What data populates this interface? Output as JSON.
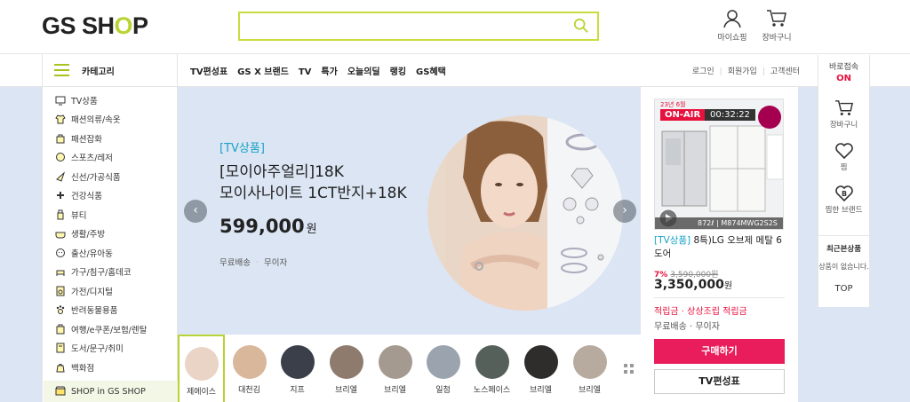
{
  "header": {
    "logo_text_1": "GS SH",
    "logo_text_o": "O",
    "logo_text_2": "P",
    "search_value": "",
    "mypage_label": "마이쇼핑",
    "cart_label": "장바구니"
  },
  "nav": {
    "category_label": "카테고리",
    "menu": [
      "TV편성표",
      "GS X 브랜드",
      "TV",
      "특가",
      "오늘의딜",
      "랭킹",
      "GS혜택"
    ],
    "login": "로그인",
    "join": "회원가입",
    "cs": "고객센터",
    "baro_label": "바로접속",
    "baro_state": "ON"
  },
  "categories": [
    {
      "label": "TV상품",
      "icon": "tv-icon"
    },
    {
      "label": "패션의류/속옷",
      "icon": "shirt-icon"
    },
    {
      "label": "패션잡화",
      "icon": "bag-icon"
    },
    {
      "label": "스포츠/레저",
      "icon": "sports-icon"
    },
    {
      "label": "신선/가공식품",
      "icon": "food-icon"
    },
    {
      "label": "건강식품",
      "icon": "health-icon"
    },
    {
      "label": "뷰티",
      "icon": "beauty-icon"
    },
    {
      "label": "생활/주방",
      "icon": "kitchen-icon"
    },
    {
      "label": "출산/유아동",
      "icon": "baby-icon"
    },
    {
      "label": "가구/침구/홈데코",
      "icon": "furniture-icon"
    },
    {
      "label": "가전/디지털",
      "icon": "appliance-icon"
    },
    {
      "label": "반려동물용품",
      "icon": "pet-icon"
    },
    {
      "label": "여행/e쿠폰/보험/렌탈",
      "icon": "travel-icon"
    },
    {
      "label": "도서/문구/취미",
      "icon": "book-icon"
    },
    {
      "label": "백화점",
      "icon": "dept-store-icon"
    }
  ],
  "shop_in": "SHOP in GS SHOP",
  "hero": {
    "tag": "[TV상품]",
    "title_line1": "[모이아주얼리]18K",
    "title_line2": "모이사나이트 1CT반지+18K",
    "price": "599,000",
    "won": "원",
    "shipping": "무료배송",
    "interest": "무이자",
    "prev": "‹",
    "next": "›"
  },
  "thumbs": [
    "제에이스",
    "대천김",
    "지프",
    "브리엘",
    "브리엘",
    "일첨",
    "노스페이스",
    "브리엘",
    "브리엘"
  ],
  "tv": {
    "badge_year": "23년 6월",
    "onair": "ON-AIR",
    "timer": "00:32:22",
    "model": "872ℓ | M874MWG2S2S",
    "tag": "[TV상품]",
    "title": " 8특)LG 오브제 메탈 6도어",
    "discount": "7%",
    "orig_price": "3,590,000원",
    "price": "3,350,000",
    "won": "원",
    "reward": "적립금 · 상상조립 적립금",
    "shipping": "무료배송 · 무이자",
    "buy_label": "구매하기",
    "schedule_label": "TV편성표"
  },
  "right": {
    "cart": "장바구니",
    "wish": "찜",
    "brand": "찜한 브랜드",
    "recent_title": "최근본상품",
    "recent_empty": "상품이 없습니다.",
    "top": "TOP"
  },
  "colors": {
    "accent": "#b8d434",
    "red": "#e7113d",
    "buy": "#e91d5c",
    "teal": "#19a3c7"
  }
}
